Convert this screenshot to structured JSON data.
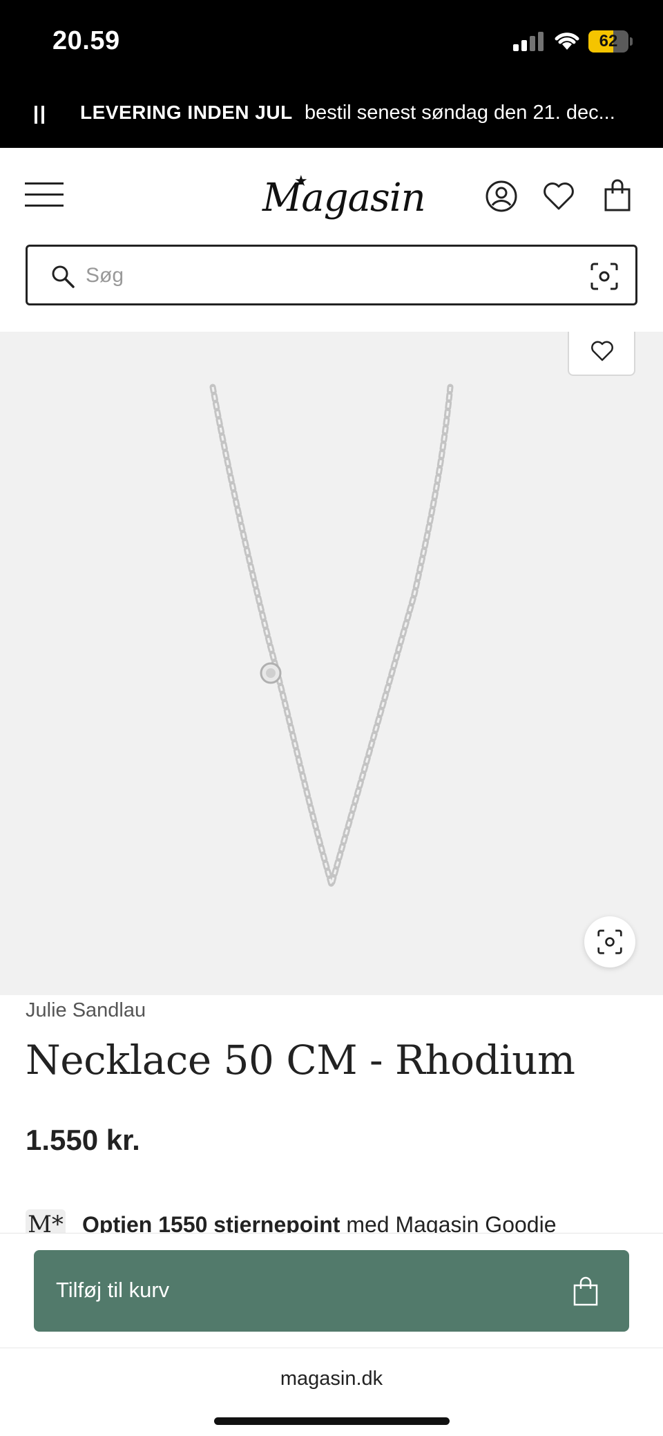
{
  "status_bar": {
    "time": "20.59",
    "battery": "62",
    "battery_color": "#f5c400"
  },
  "promo": {
    "bold": "LEVERING INDEN JUL",
    "text": "bestil senest søndag den 21. dec..."
  },
  "header": {
    "logo": "Magasin",
    "logo_star": "★",
    "icons": [
      "menu-icon",
      "account-icon",
      "heart-icon",
      "bag-icon"
    ]
  },
  "search": {
    "placeholder": "Søg"
  },
  "product": {
    "brand": "Julie Sandlau",
    "name": "Necklace 50 CM - Rhodium",
    "price": "1.550 kr.",
    "image_bg": "#f1f1f1"
  },
  "points": {
    "logo": "M*",
    "bold": "Optjen 1550 stjernepoint",
    "text": " med Magasin Goodie"
  },
  "cart": {
    "label": "Tilføj til kurv",
    "color": "#527a6b"
  },
  "browser": {
    "url": "magasin.dk"
  }
}
